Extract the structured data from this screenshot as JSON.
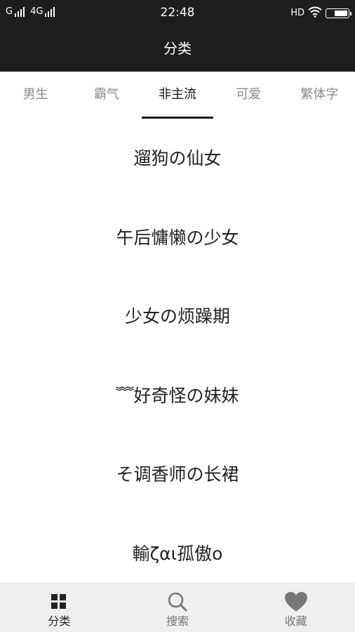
{
  "status_bar": {
    "carrier1": "G",
    "carrier2": "4G",
    "time": "22:48",
    "hd": "HD",
    "battery_level": 0.65
  },
  "header": {
    "title": "分类"
  },
  "tabs": [
    {
      "label": "男生",
      "active": false
    },
    {
      "label": "霸气",
      "active": false
    },
    {
      "label": "非主流",
      "active": true
    },
    {
      "label": "可爱",
      "active": false
    },
    {
      "label": "繁体字",
      "active": false
    }
  ],
  "list": {
    "items": [
      "遛狗の仙女",
      "午后慵懒の少女",
      "少女の烦躁期",
      "﹌好奇怪の妹妹",
      "そ调香师の长裙",
      "輸ζαι孤傲o"
    ]
  },
  "bottom_nav": [
    {
      "label": "分类",
      "icon": "grid-icon",
      "active": true
    },
    {
      "label": "搜索",
      "icon": "search-icon",
      "active": false
    },
    {
      "label": "收藏",
      "icon": "heart-icon",
      "active": false
    }
  ],
  "colors": {
    "bar": "#1e1e1e",
    "nav_bg": "#efefef",
    "inactive_tab": "#8a8a8a"
  }
}
